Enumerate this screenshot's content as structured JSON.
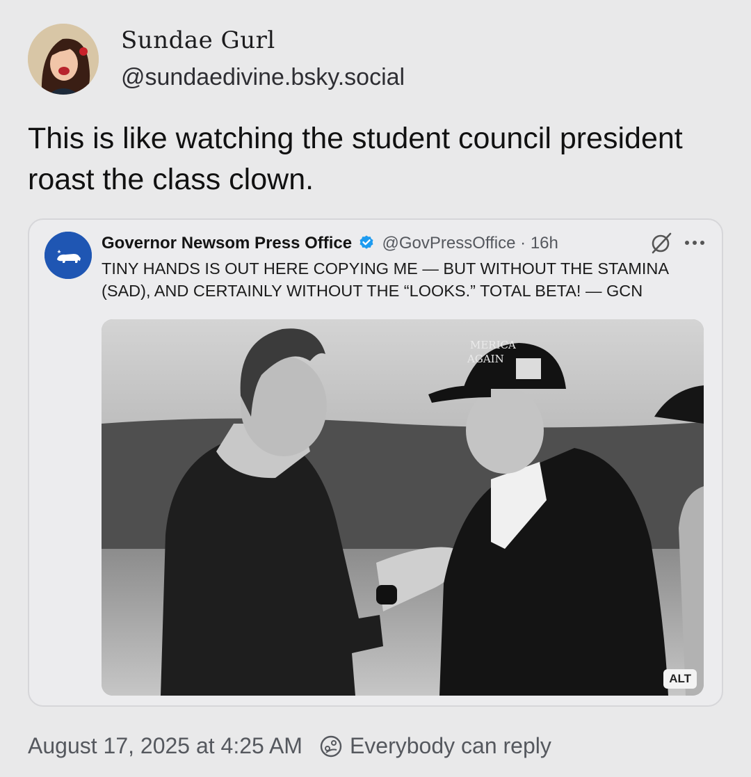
{
  "post": {
    "author": {
      "display_name": "Sundae Gurl",
      "handle": "@sundaedivine.bsky.social"
    },
    "text": "This is like watching the student council president roast the class clown.",
    "timestamp": "August 17, 2025 at 4:25 AM",
    "reply_setting": "Everybody can reply"
  },
  "quote": {
    "name": "Governor Newsom Press Office",
    "handle": "@GovPressOffice",
    "separator": "·",
    "age": "16h",
    "text": "TINY HANDS IS OUT HERE COPYING ME — BUT WITHOUT THE STAMINA (SAD), AND CERTAINLY WITHOUT THE “LOOKS.” TOTAL BETA! — GCN",
    "image": {
      "alt_badge": "ALT",
      "hat_text_line1": "MERICA",
      "hat_text_line2": "AGAIN"
    }
  },
  "icons": {
    "verified": "verified-badge-icon",
    "grok": "grok-icon",
    "more": "more-icon",
    "reply_setting": "reply-setting-icon"
  },
  "colors": {
    "background": "#e9e9ea",
    "verified": "#1d9bf0",
    "quote_avatar": "#1f56b3"
  }
}
